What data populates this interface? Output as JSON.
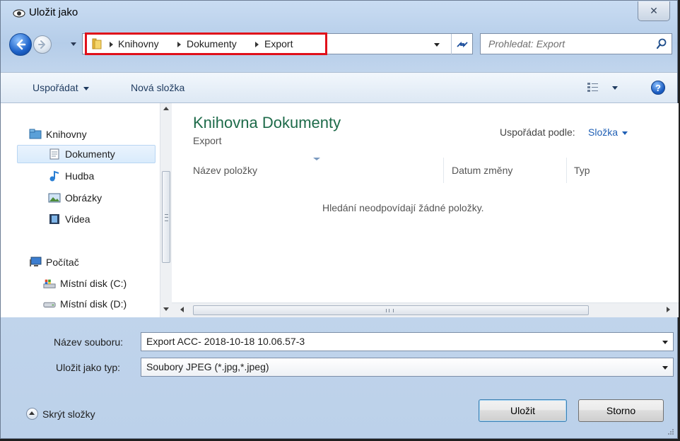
{
  "window": {
    "title": "Uložit jako",
    "close_label": "✕"
  },
  "address": {
    "crumbs": [
      "Knihovny",
      "Dokumenty",
      "Export"
    ]
  },
  "search": {
    "placeholder": "Prohledat: Export"
  },
  "toolbar": {
    "organize": "Uspořádat",
    "new_folder": "Nová složka"
  },
  "nav_tree": {
    "items": [
      {
        "label": "Knihovny",
        "icon": "libraries-icon"
      },
      {
        "label": "Dokumenty",
        "icon": "documents-icon",
        "selected": true
      },
      {
        "label": "Hudba",
        "icon": "music-icon"
      },
      {
        "label": "Obrázky",
        "icon": "pictures-icon"
      },
      {
        "label": "Videa",
        "icon": "videos-icon"
      },
      {
        "label": "Počítač",
        "icon": "computer-icon"
      },
      {
        "label": "Místní disk (C:)",
        "icon": "system-drive-icon"
      },
      {
        "label": "Místní disk (D:)",
        "icon": "drive-icon"
      }
    ]
  },
  "content": {
    "library_title": "Knihovna Dokumenty",
    "library_subtitle": "Export",
    "arrange_label": "Uspořádat podle:",
    "arrange_value": "Složka",
    "columns": [
      "Název položky",
      "Datum změny",
      "Typ"
    ],
    "empty_message": "Hledání neodpovídají žádné položky."
  },
  "form": {
    "filename_label": "Název souboru:",
    "filename_value": "Export ACC- 2018-10-18 10.06.57-3",
    "filetype_label": "Uložit jako typ:",
    "filetype_value": "Soubory JPEG (*.jpg,*.jpeg)"
  },
  "footer": {
    "hide_folders": "Skrýt složky",
    "save_button": "Uložit",
    "cancel_button": "Storno"
  },
  "colors": {
    "accent_title": "#1e6b4a",
    "link_blue": "#1f5fb5",
    "highlight_red": "#e0101a"
  }
}
